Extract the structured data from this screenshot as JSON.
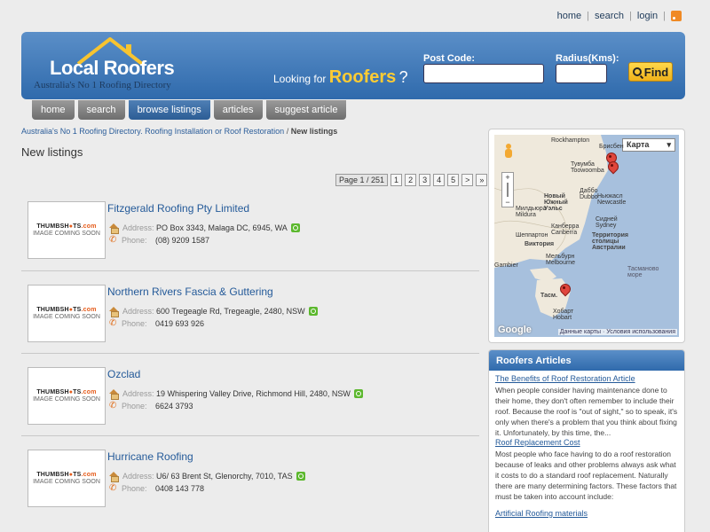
{
  "toplinks": {
    "home": "home",
    "search": "search",
    "login": "login"
  },
  "logo": {
    "name": "Local Roofers",
    "tagline": "Australia's No 1 Roofing Directory"
  },
  "header": {
    "looking_for": "Looking for",
    "keyword": "Roofers",
    "question_mark": "?",
    "postcode_label": "Post Code:",
    "postcode_value": "",
    "radius_label": "Radius(Kms):",
    "radius_value": "",
    "find_label": "Find"
  },
  "nav": [
    {
      "label": "home",
      "active": false
    },
    {
      "label": "search",
      "active": false
    },
    {
      "label": "browse listings",
      "active": true
    },
    {
      "label": "articles",
      "active": false
    },
    {
      "label": "suggest article",
      "active": false
    }
  ],
  "breadcrumb": {
    "link": "Australia's No 1 Roofing Directory. Roofing Installation or Roof Restoration",
    "separator": "/",
    "current": "New listings"
  },
  "page_title": "New listings",
  "pagination": {
    "info": "Page 1 / 251",
    "pages": [
      "1",
      "2",
      "3",
      "4",
      "5",
      ">",
      "»"
    ]
  },
  "thumbnail": {
    "brand_a": "THUMBSH",
    "brand_dot": "●",
    "brand_b": "TS",
    "brand_suffix": ".com",
    "note": "IMAGE COMING SOON"
  },
  "field_labels": {
    "address": "Address:",
    "phone": "Phone:"
  },
  "listings": [
    {
      "name": "Fitzgerald Roofing Pty Limited",
      "address": "PO Box 3343, Malaga DC, 6945, WA",
      "phone": "(08) 9209 1587"
    },
    {
      "name": "Northern Rivers Fascia & Guttering",
      "address": "600 Tregeagle Rd, Tregeagle, 2480, NSW",
      "phone": "0419 693 926"
    },
    {
      "name": "Ozclad",
      "address": "19 Whispering Valley Drive, Richmond Hill, 2480, NSW",
      "phone": "6624 3793"
    },
    {
      "name": "Hurricane Roofing",
      "address": "U6/ 63 Brent St, Glenorchy, 7010, TAS",
      "phone": "0408 143 778"
    }
  ],
  "map": {
    "type_label": "Карта",
    "footer": "Данные карты · Условия использования",
    "google": "Google",
    "labels": {
      "rockhampton": "Rockhampton",
      "brisbane": "Брисбен",
      "toowoomba": "Тувумба\nToowoomba",
      "dubbo": "Даббо\nDubbo",
      "nsw": "Новый\nЮжный\nУэльс",
      "mildura": "Милдьюра\nMildura",
      "canberra": "Канберра\nCanberra",
      "newcastle": "Ньюкасл\nNewcastle",
      "sydney": "Сидней\nSydney",
      "act": "Территория\nстолицы\nАвстралии",
      "shepparton": "Шеппартон",
      "victoria": "Виктория",
      "melbourne": "Мельбурн\nMelbourne",
      "gambier": "Gambier",
      "tasman_sea": "Тасманово\nморе",
      "tas": "Тасм.",
      "hobart": "Хобарт\nHobart"
    }
  },
  "articles": {
    "heading": "Roofers Articles",
    "items": [
      {
        "title": "The Benefits of Roof Restoration Article",
        "body": "When people consider having maintenance done to their home, they don't often remember to include their roof. Because the roof is \"out of sight,\" so to speak, it's only when there's a problem that you think about fixing it. Unfortunately, by this time, the..."
      },
      {
        "title": "Roof Replacement Cost",
        "body": "Most people who face having to do a roof restoration because of leaks and other problems always ask what it costs to do a standard roof replacement. Naturally there are many determining factors. These factors that must be taken into account include:"
      },
      {
        "title": "Artificial Roofing materials",
        "body": ""
      }
    ]
  },
  "colors": {
    "brand_blue": "#2f6aac",
    "accent_yellow": "#ffcc33",
    "link_blue": "#245a99"
  }
}
